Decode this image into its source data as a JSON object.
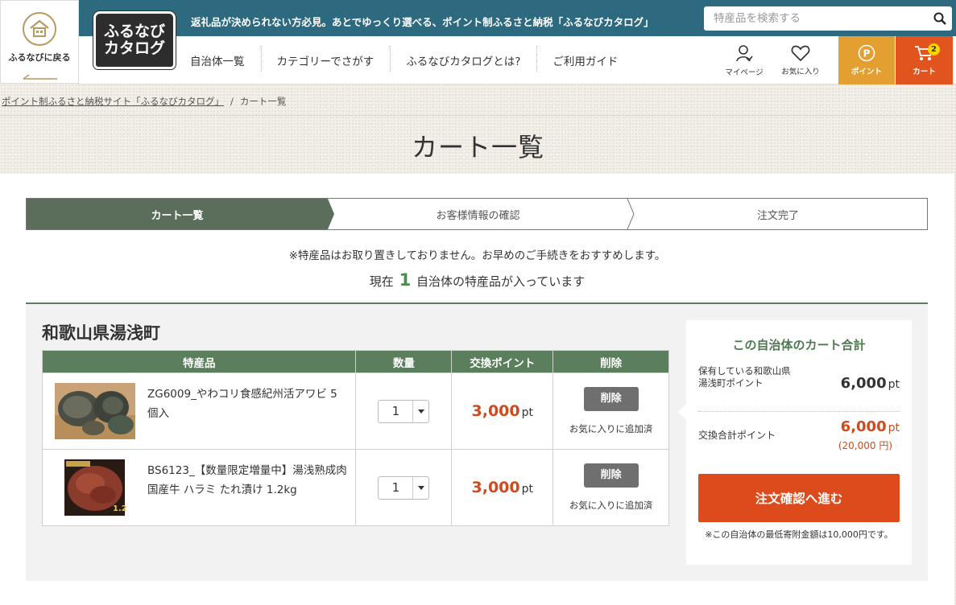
{
  "header": {
    "back_label": "ふるなびに戻る",
    "logo_line1": "ふるなび",
    "logo_line2": "カタログ",
    "tagline": "返礼品が決められない方必見。あとでゆっくり選べる、ポイント制ふるさと納税「ふるなびカタログ」",
    "search_placeholder": "特産品を検索する",
    "nav": [
      "自治体一覧",
      "カテゴリーでさがす",
      "ふるなびカタログとは?",
      "ご利用ガイド"
    ],
    "mypage_label": "マイページ",
    "favorites_label": "お気に入り",
    "point_label": "ポイント",
    "cart_label": "カート",
    "cart_count": "2",
    "colors": {
      "topbar": "#2e6a7f",
      "point": "#e3a031",
      "cart": "#e2541e"
    }
  },
  "breadcrumb": {
    "home": "ポイント制ふるさと納税サイト「ふるなびカタログ」",
    "separator": "/",
    "current": "カート一覧"
  },
  "page_title": "カート一覧",
  "steps": [
    "カート一覧",
    "お客様情報の確認",
    "注文完了"
  ],
  "notice": "※特産品はお取り置きしておりません。お早めのご手続きをおすすめします。",
  "count_line": {
    "prefix": "現在",
    "count": "1",
    "suffix": "自治体の特産品が入っています"
  },
  "municipality": {
    "name": "和歌山県湯浅町",
    "table_headers": [
      "特産品",
      "数量",
      "交換ポイント",
      "削除"
    ],
    "items": [
      {
        "name": "ZG6009_やわコリ食感紀州活アワビ 5個入",
        "quantity": "1",
        "points": "3,000",
        "unit": "pt",
        "delete_label": "削除",
        "fav_status": "お気に入りに追加済"
      },
      {
        "name": "BS6123_【数量限定増量中】湯浅熟成肉 国産牛 ハラミ たれ漬け 1.2kg",
        "quantity": "1",
        "points": "3,000",
        "unit": "pt",
        "delete_label": "削除",
        "fav_status": "お気に入りに追加済"
      }
    ]
  },
  "summary": {
    "title": "この自治体のカート合計",
    "owned_label": "保有している和歌山県湯浅町ポイント",
    "owned_value": "6,000",
    "total_label": "交換合計ポイント",
    "total_value": "6,000",
    "unit": "pt",
    "yen": "(20,000 円)",
    "order_button": "注文確認へ進む",
    "min_note": "※この自治体の最低寄附金額は10,000円です。",
    "accent": "#dd4a1b"
  }
}
